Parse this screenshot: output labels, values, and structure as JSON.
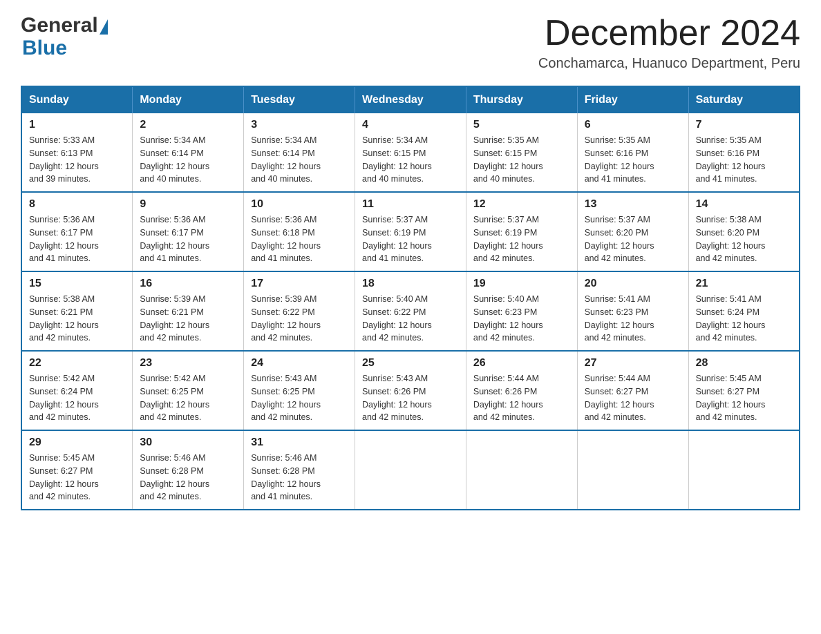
{
  "header": {
    "logo_general": "General",
    "logo_blue": "Blue",
    "month_title": "December 2024",
    "location": "Conchamarca, Huanuco Department, Peru"
  },
  "weekdays": [
    "Sunday",
    "Monday",
    "Tuesday",
    "Wednesday",
    "Thursday",
    "Friday",
    "Saturday"
  ],
  "weeks": [
    [
      {
        "day": "1",
        "sunrise": "5:33 AM",
        "sunset": "6:13 PM",
        "daylight": "12 hours and 39 minutes."
      },
      {
        "day": "2",
        "sunrise": "5:34 AM",
        "sunset": "6:14 PM",
        "daylight": "12 hours and 40 minutes."
      },
      {
        "day": "3",
        "sunrise": "5:34 AM",
        "sunset": "6:14 PM",
        "daylight": "12 hours and 40 minutes."
      },
      {
        "day": "4",
        "sunrise": "5:34 AM",
        "sunset": "6:15 PM",
        "daylight": "12 hours and 40 minutes."
      },
      {
        "day": "5",
        "sunrise": "5:35 AM",
        "sunset": "6:15 PM",
        "daylight": "12 hours and 40 minutes."
      },
      {
        "day": "6",
        "sunrise": "5:35 AM",
        "sunset": "6:16 PM",
        "daylight": "12 hours and 41 minutes."
      },
      {
        "day": "7",
        "sunrise": "5:35 AM",
        "sunset": "6:16 PM",
        "daylight": "12 hours and 41 minutes."
      }
    ],
    [
      {
        "day": "8",
        "sunrise": "5:36 AM",
        "sunset": "6:17 PM",
        "daylight": "12 hours and 41 minutes."
      },
      {
        "day": "9",
        "sunrise": "5:36 AM",
        "sunset": "6:17 PM",
        "daylight": "12 hours and 41 minutes."
      },
      {
        "day": "10",
        "sunrise": "5:36 AM",
        "sunset": "6:18 PM",
        "daylight": "12 hours and 41 minutes."
      },
      {
        "day": "11",
        "sunrise": "5:37 AM",
        "sunset": "6:19 PM",
        "daylight": "12 hours and 41 minutes."
      },
      {
        "day": "12",
        "sunrise": "5:37 AM",
        "sunset": "6:19 PM",
        "daylight": "12 hours and 42 minutes."
      },
      {
        "day": "13",
        "sunrise": "5:37 AM",
        "sunset": "6:20 PM",
        "daylight": "12 hours and 42 minutes."
      },
      {
        "day": "14",
        "sunrise": "5:38 AM",
        "sunset": "6:20 PM",
        "daylight": "12 hours and 42 minutes."
      }
    ],
    [
      {
        "day": "15",
        "sunrise": "5:38 AM",
        "sunset": "6:21 PM",
        "daylight": "12 hours and 42 minutes."
      },
      {
        "day": "16",
        "sunrise": "5:39 AM",
        "sunset": "6:21 PM",
        "daylight": "12 hours and 42 minutes."
      },
      {
        "day": "17",
        "sunrise": "5:39 AM",
        "sunset": "6:22 PM",
        "daylight": "12 hours and 42 minutes."
      },
      {
        "day": "18",
        "sunrise": "5:40 AM",
        "sunset": "6:22 PM",
        "daylight": "12 hours and 42 minutes."
      },
      {
        "day": "19",
        "sunrise": "5:40 AM",
        "sunset": "6:23 PM",
        "daylight": "12 hours and 42 minutes."
      },
      {
        "day": "20",
        "sunrise": "5:41 AM",
        "sunset": "6:23 PM",
        "daylight": "12 hours and 42 minutes."
      },
      {
        "day": "21",
        "sunrise": "5:41 AM",
        "sunset": "6:24 PM",
        "daylight": "12 hours and 42 minutes."
      }
    ],
    [
      {
        "day": "22",
        "sunrise": "5:42 AM",
        "sunset": "6:24 PM",
        "daylight": "12 hours and 42 minutes."
      },
      {
        "day": "23",
        "sunrise": "5:42 AM",
        "sunset": "6:25 PM",
        "daylight": "12 hours and 42 minutes."
      },
      {
        "day": "24",
        "sunrise": "5:43 AM",
        "sunset": "6:25 PM",
        "daylight": "12 hours and 42 minutes."
      },
      {
        "day": "25",
        "sunrise": "5:43 AM",
        "sunset": "6:26 PM",
        "daylight": "12 hours and 42 minutes."
      },
      {
        "day": "26",
        "sunrise": "5:44 AM",
        "sunset": "6:26 PM",
        "daylight": "12 hours and 42 minutes."
      },
      {
        "day": "27",
        "sunrise": "5:44 AM",
        "sunset": "6:27 PM",
        "daylight": "12 hours and 42 minutes."
      },
      {
        "day": "28",
        "sunrise": "5:45 AM",
        "sunset": "6:27 PM",
        "daylight": "12 hours and 42 minutes."
      }
    ],
    [
      {
        "day": "29",
        "sunrise": "5:45 AM",
        "sunset": "6:27 PM",
        "daylight": "12 hours and 42 minutes."
      },
      {
        "day": "30",
        "sunrise": "5:46 AM",
        "sunset": "6:28 PM",
        "daylight": "12 hours and 42 minutes."
      },
      {
        "day": "31",
        "sunrise": "5:46 AM",
        "sunset": "6:28 PM",
        "daylight": "12 hours and 41 minutes."
      },
      null,
      null,
      null,
      null
    ]
  ],
  "labels": {
    "sunrise_prefix": "Sunrise: ",
    "sunset_prefix": "Sunset: ",
    "daylight_prefix": "Daylight: "
  }
}
